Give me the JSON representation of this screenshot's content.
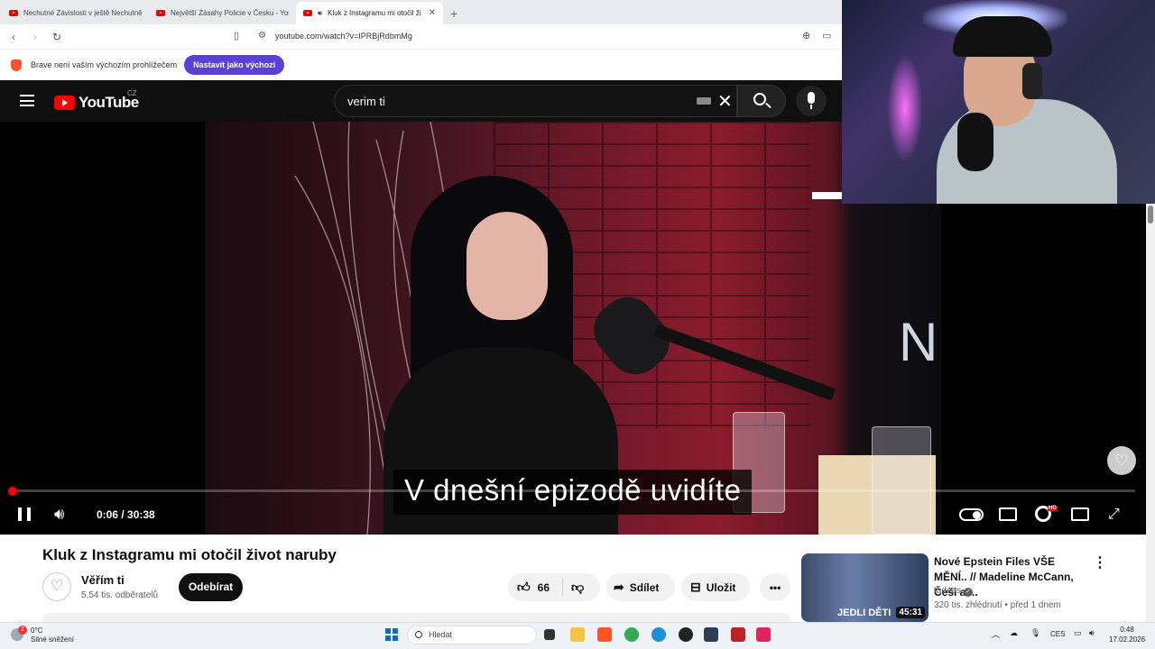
{
  "browser": {
    "tabs": [
      {
        "label": "Nechutné Závislosti v ještě Nechutněj"
      },
      {
        "label": "Největší Zásahy Policie v Česku - You"
      },
      {
        "label": "Kluk z Instagramu mi otočil ži"
      }
    ],
    "new_tab": "+",
    "url": "youtube.com/watch?v=IPRBjRdbmMg",
    "infobar_text": "Brave není vaším výchozím prohlížečem",
    "infobar_button": "Nastavit jako výchozí"
  },
  "youtube": {
    "logo_text": "YouTube",
    "region": "CZ",
    "search_value": "verim ti"
  },
  "player": {
    "subtitle": "V dnešní epizodě uvidíte",
    "time": "0:06 / 30:38",
    "progress": 0.003,
    "scene_text": "N"
  },
  "video": {
    "title": "Kluk z Instagramu mi otočil život naruby",
    "channel": "Věřím ti",
    "subscribers": "5,54 tis. odběratelů",
    "subscribe_label": "Odebírat",
    "likes": "66",
    "share_label": "Sdílet",
    "save_label": "Uložit"
  },
  "recommended": {
    "title": "Nové Epstein Files VŠE MĚNÍ.. // Madeline McCann, Češi a ...",
    "channel": "tadeas",
    "meta": "320 tis. zhlédnutí • před 1 dnem",
    "duration": "45:31",
    "thumb_text": "JEDLI DĚTI"
  },
  "taskbar": {
    "weather_temp": "0°C",
    "weather_desc": "Silné sněžení",
    "weather_badge": "2",
    "search_placeholder": "Hledat",
    "language": "CES",
    "time": "0:48",
    "date": "17.02.2026"
  },
  "colors": {
    "youtube_red": "#ff0000",
    "brave_purple": "#5a3fd8"
  }
}
